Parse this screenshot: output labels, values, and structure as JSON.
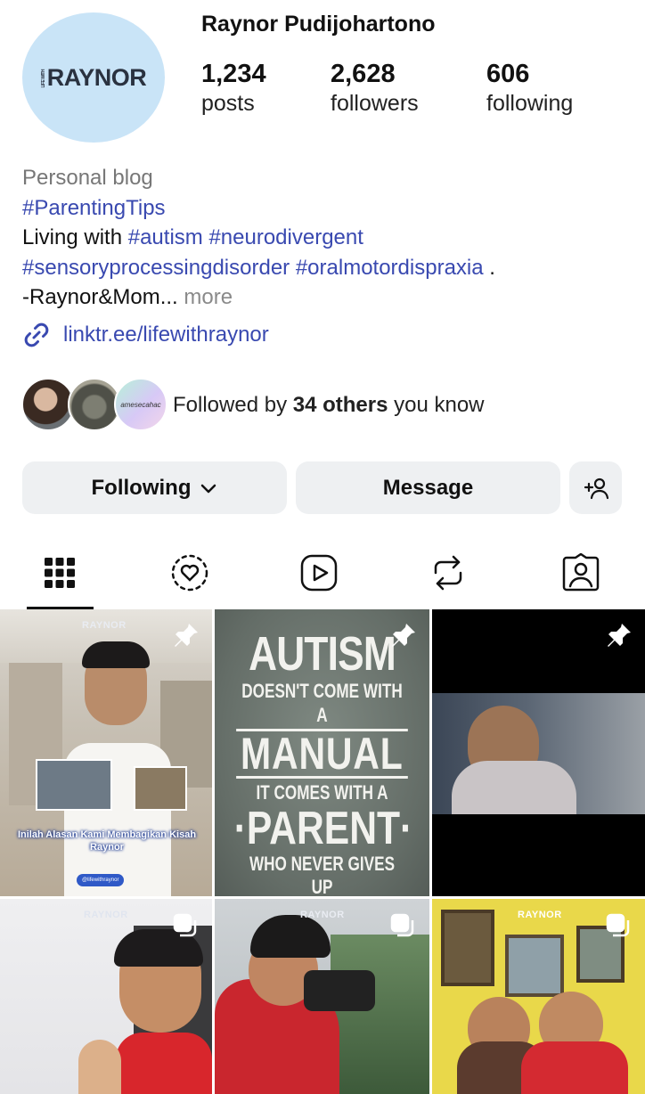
{
  "profile": {
    "username": "Raynor Pudijohartono",
    "avatar_text": "RAYNOR",
    "stats": [
      {
        "value": "1,234",
        "label": "posts"
      },
      {
        "value": "2,628",
        "label": "followers"
      },
      {
        "value": "606",
        "label": "following"
      }
    ]
  },
  "bio": {
    "category": "Personal blog",
    "tag_parenting": "#ParentingTips",
    "living_prefix": "Living with ",
    "tag_autism": "#autism",
    "tag_neuro": "#neurodivergent",
    "tag_sensory": "#sensoryprocessingdisorder",
    "tag_oral": "#oralmotordispraxia",
    "period": " .",
    "signature": "-Raynor&Mom...",
    "more": " more",
    "link": "linktr.ee/lifewithraynor"
  },
  "followed_by": {
    "prefix": "Followed by ",
    "bold": "34 others",
    "suffix": " you know",
    "third_avatar_text": "amesecahac"
  },
  "buttons": {
    "following": "Following",
    "message": "Message"
  },
  "tabs": [
    "grid",
    "reels-heart",
    "reels",
    "reposts",
    "tagged"
  ],
  "posts": {
    "watermark": "RAYNOR",
    "post1_caption": "Inilah Alasan Kami Membagikan Kisah Raynor",
    "post1_handle": "@lifewithraynor",
    "post2_lines": [
      "AUTISM",
      "DOESN'T COME WITH A",
      "MANUAL",
      "IT COMES WITH A",
      "·PARENT·",
      "WHO NEVER GIVES UP"
    ]
  },
  "colors": {
    "link": "#3949b0",
    "button_bg": "#eef0f2",
    "avatar_bg": "#c9e4f7"
  }
}
